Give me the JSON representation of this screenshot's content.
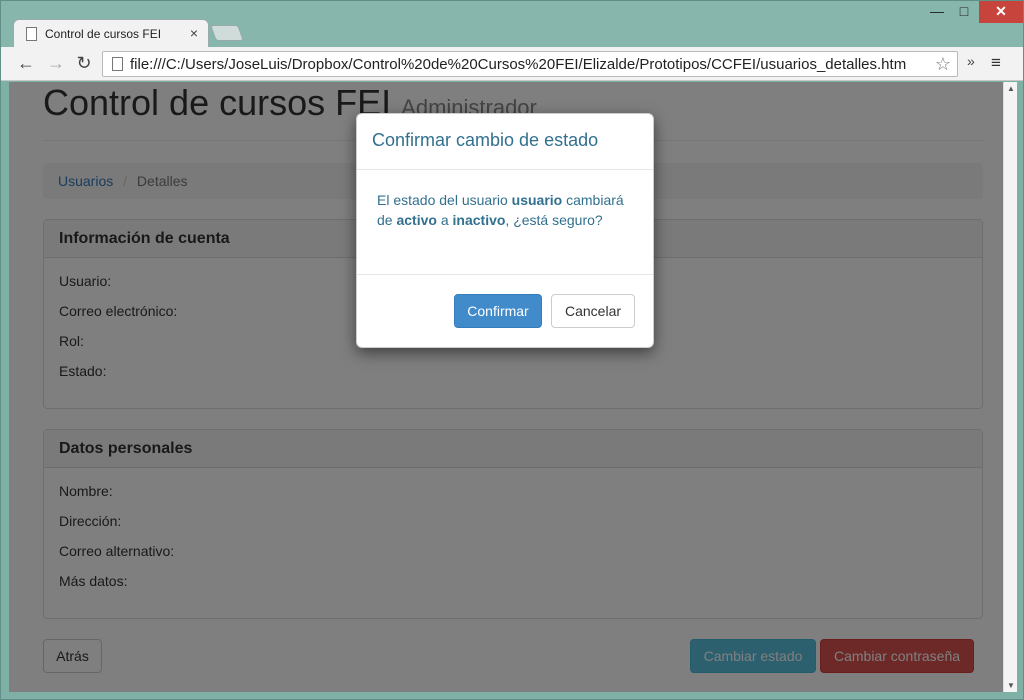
{
  "browser": {
    "tab_title": "Control de cursos FEI",
    "url": "file:///C:/Users/JoseLuis/Dropbox/Control%20de%20Cursos%20FEI/Elizalde/Prototipos/CCFEI/usuarios_detalles.htm",
    "min_label": "—",
    "max_label": "□",
    "close_label": "✕",
    "tab_close": "×",
    "back": "←",
    "forward": "→",
    "reload": "↻",
    "star": "☆",
    "more": "»",
    "menu": "≡"
  },
  "page": {
    "title": "Control de cursos FEI",
    "subtitle": "Administrador",
    "breadcrumb": {
      "link": "Usuarios",
      "separator": "/",
      "active": "Detalles"
    },
    "account_panel": {
      "heading": "Información de cuenta",
      "fields": [
        "Usuario:",
        "Correo electrónico:",
        "Rol:",
        "Estado:"
      ]
    },
    "personal_panel": {
      "heading": "Datos personales",
      "fields": [
        "Nombre:",
        "Dirección:",
        "Correo alternativo:",
        "Más datos:"
      ]
    },
    "buttons": {
      "back": "Atrás",
      "change_state": "Cambiar estado",
      "change_password": "Cambiar contraseña"
    }
  },
  "modal": {
    "title": "Confirmar cambio de estado",
    "body": {
      "part1": "El estado del usuario ",
      "user": "usuario",
      "part2": " cambiará de ",
      "from": "activo",
      "part3": " a ",
      "to": "inactivo",
      "part4": ", ¿está seguro?"
    },
    "confirm": "Confirmar",
    "cancel": "Cancelar"
  }
}
